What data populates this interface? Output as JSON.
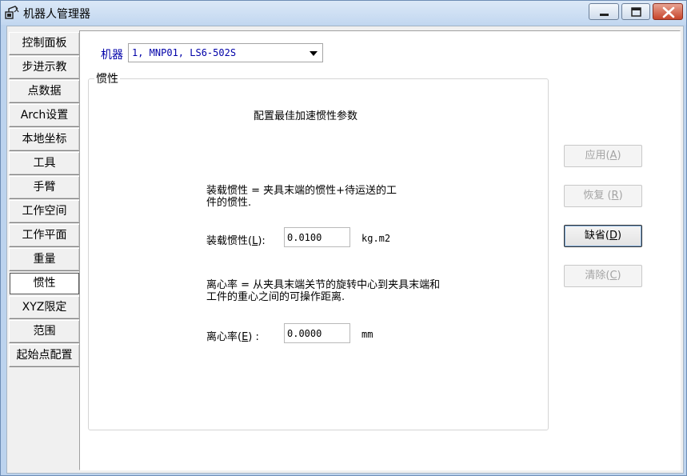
{
  "window": {
    "title": "机器人管理器"
  },
  "tabs": [
    {
      "id": "control-panel",
      "label": "控制面板",
      "active": false
    },
    {
      "id": "jog",
      "label": "步进示教",
      "active": false
    },
    {
      "id": "points",
      "label": "点数据",
      "active": false
    },
    {
      "id": "arch",
      "label": "Arch设置",
      "active": false
    },
    {
      "id": "local",
      "label": "本地坐标",
      "active": false
    },
    {
      "id": "tool",
      "label": "工具",
      "active": false
    },
    {
      "id": "arm",
      "label": "手臂",
      "active": false
    },
    {
      "id": "workspace",
      "label": "工作空间",
      "active": false
    },
    {
      "id": "workplane",
      "label": "工作平面",
      "active": false
    },
    {
      "id": "weight",
      "label": "重量",
      "active": false
    },
    {
      "id": "inertia",
      "label": "惯性",
      "active": true
    },
    {
      "id": "xyz-limits",
      "label": "XYZ限定",
      "active": false
    },
    {
      "id": "range",
      "label": "范围",
      "active": false
    },
    {
      "id": "home-config",
      "label": "起始点配置",
      "active": false
    }
  ],
  "robot": {
    "label": "机器",
    "selected": "1, MNP01, LS6-502S"
  },
  "group": {
    "title": "惯性",
    "heading": "配置最佳加速惯性参数",
    "load": {
      "desc_line1": "装载惯性 = 夹具末端的惯性+待运送的工",
      "desc_line2": "件的惯性.",
      "label_pre": "装载惯性(",
      "label_key": "L",
      "label_post": "):",
      "value": "0.0100",
      "unit": "kg.m2"
    },
    "ecc": {
      "desc_line1": "离心率 = 从夹具末端关节的旋转中心到夹具末端和",
      "desc_line2": "工件的重心之间的可操作距离.",
      "label_pre": "离心率(",
      "label_key": "E",
      "label_post": ") :",
      "value": "0.0000",
      "unit": "mm"
    }
  },
  "buttons": {
    "apply": {
      "pre": "应用(",
      "key": "A",
      "post": ")"
    },
    "restore": {
      "pre": "恢复 (",
      "key": "R",
      "post": ")"
    },
    "default": {
      "pre": "缺省(",
      "key": "D",
      "post": ")"
    },
    "clear": {
      "pre": "清除(",
      "key": "C",
      "post": ")"
    }
  },
  "colors": {
    "label_blue": "#0000a8",
    "disabled_text": "#a3a3a3"
  }
}
